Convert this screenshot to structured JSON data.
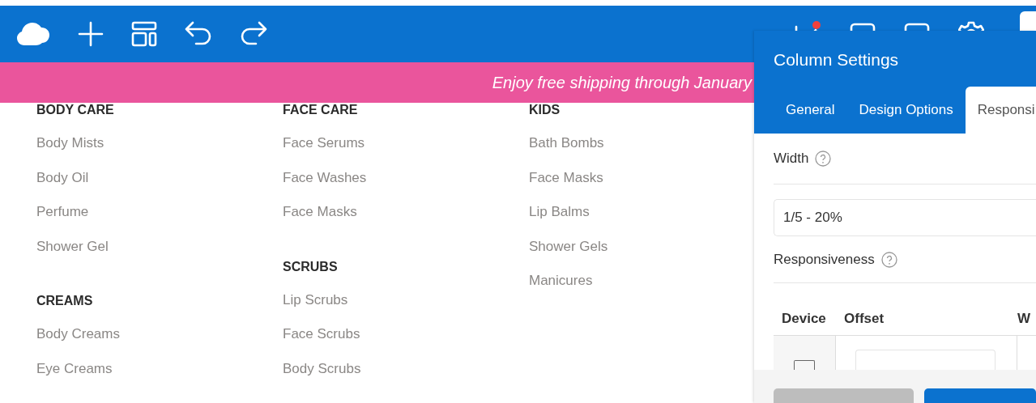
{
  "banner": {
    "text": "Enjoy free shipping through January"
  },
  "menu": {
    "columns": [
      {
        "groups": [
          {
            "heading": "BODY CARE",
            "items": [
              "Body Mists",
              "Body Oil",
              "Perfume",
              "Shower Gel"
            ]
          },
          {
            "heading": "CREAMS",
            "items": [
              "Body Creams",
              "Eye Creams"
            ]
          }
        ]
      },
      {
        "groups": [
          {
            "heading": "FACE CARE",
            "items": [
              "Face Serums",
              "Face Washes",
              "Face Masks"
            ]
          },
          {
            "heading": "SCRUBS",
            "items": [
              "Lip Scrubs",
              "Face Scrubs",
              "Body Scrubs"
            ]
          }
        ]
      },
      {
        "groups": [
          {
            "heading": "KIDS",
            "items": [
              "Bath Bombs",
              "Face Masks",
              "Lip Balms",
              "Shower Gels",
              "Manicures"
            ]
          }
        ]
      }
    ]
  },
  "panel": {
    "title": "Column Settings",
    "tabs": [
      {
        "label": "General",
        "selected": false
      },
      {
        "label": "Design Options",
        "selected": false
      },
      {
        "label": "Responsi",
        "selected": true
      }
    ],
    "width": {
      "label": "Width",
      "value": "1/5 - 20%"
    },
    "responsiveness": {
      "label": "Responsiveness",
      "columns": [
        "Device",
        "Offset",
        "W"
      ]
    }
  }
}
